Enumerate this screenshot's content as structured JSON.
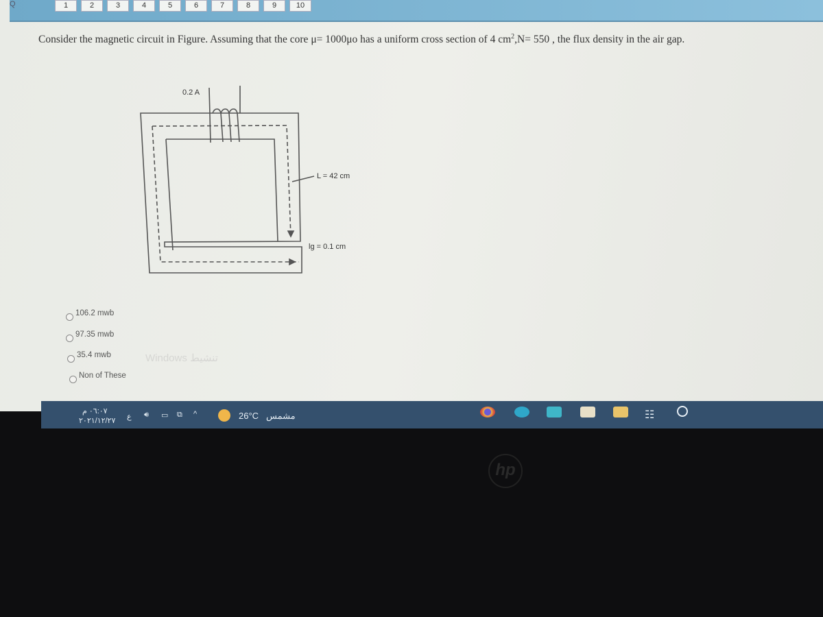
{
  "nav": {
    "question_numbers": [
      "1",
      "2",
      "3",
      "4",
      "5",
      "6",
      "7",
      "8",
      "9",
      "10"
    ]
  },
  "question": {
    "text_before": "Consider the magnetic circuit in Figure. Assuming that the core μ= 1000μo has a uniform cross section of 4 cm",
    "sup": "2",
    "text_after": ",N= 550 ,  the flux density in the air gap."
  },
  "figure": {
    "current_label": "0.2 A",
    "length_label": "L = 42 cm",
    "gap_label": "lg = 0.1 cm"
  },
  "options": [
    {
      "label": "106.2 mwb"
    },
    {
      "label": "97.35 mwb"
    },
    {
      "label": "35.4 mwb"
    },
    {
      "label": "Non of These"
    }
  ],
  "watermark": "Windows تنشيط",
  "taskbar": {
    "time": "٠٦:٠٧ م",
    "date": "٢٠٢١/١٢/٢٧",
    "lang": "ع",
    "weather_temp": "26°C",
    "weather_text": "مشمس",
    "apps": [
      "chrome-icon",
      "edge-icon",
      "mail-icon",
      "store-icon",
      "file-explorer-icon",
      "task-view-icon",
      "search-circle-icon"
    ]
  },
  "bezel": {
    "logo": "hp"
  }
}
